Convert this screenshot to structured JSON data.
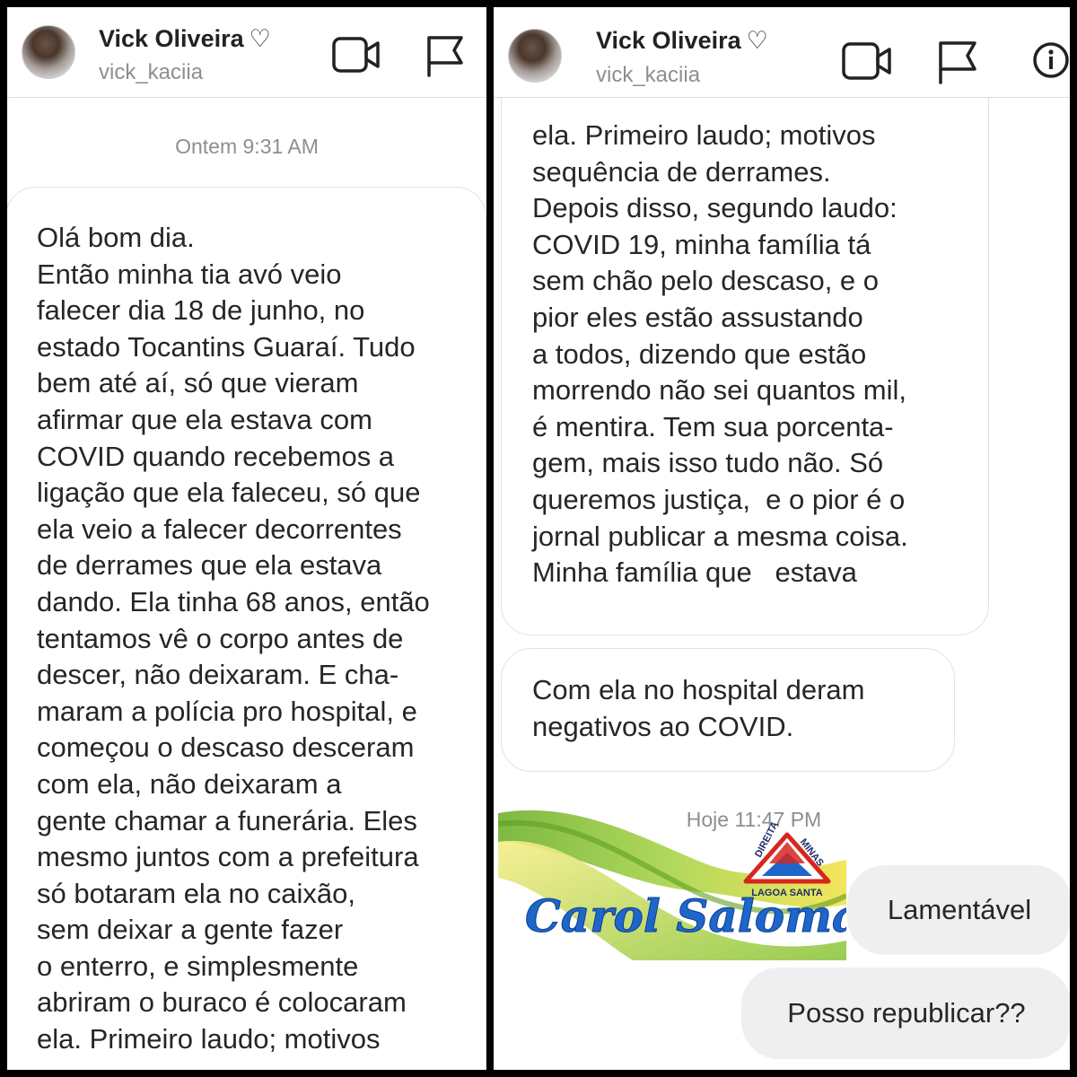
{
  "left_panel": {
    "header": {
      "name": "Vick Oliveira",
      "heart": "♡",
      "handle": "vick_kaciia",
      "video_icon": "video-call-icon",
      "flag_icon": "report-flag-icon"
    },
    "timestamp": "Ontem 9:31 AM",
    "message": "Olá bom dia.\nEntão minha tia avó veio\nfalecer dia 18 de junho, no\nestado Tocantins Guaraí. Tudo\nbem até aí, só que vieram\nafirmar que ela estava com\nCOVID quando recebemos a\nligação que ela faleceu, só que\nela veio a falecer decorrentes\nde derrames que ela estava\ndando. Ela tinha 68 anos, então\ntentamos vê o corpo antes de\ndescer, não deixaram. E cha-\nmaram a polícia pro hospital, e\ncomeçou o descaso desceram\ncom ela, não deixaram a\ngente chamar a funerária. Eles\nmesmo juntos com a prefeitura\nsó botaram ela no caixão,\nsem deixar a gente fazer\no enterro, e simplesmente\nabriram o buraco é colocaram\nela. Primeiro laudo; motivos"
  },
  "right_panel": {
    "header": {
      "name": "Vick Oliveira",
      "heart": "♡",
      "handle": "vick_kaciia",
      "video_icon": "video-call-icon",
      "flag_icon": "report-flag-icon",
      "info_icon": "info-icon"
    },
    "message_continued": "ela. Primeiro laudo; motivos\nsequência de derrames.\nDepois disso, segundo laudo:\nCOVID 19, minha família tá\nsem chão pelo descaso, e o\npior eles estão assustando\na todos, dizendo que estão\nmorrendo não sei quantos mil,\né mentira. Tem sua porcenta-\ngem, mais isso tudo não. Só\nqueremos justiça,  e o pior é o\njornal publicar a mesma coisa.\nMinha família que   estava",
    "message_2": "Com ela no hospital deram\nnegativos ao COVID.",
    "timestamp": "Hoje 11:47 PM",
    "outgoing_1": "Lamentável",
    "outgoing_2": "Posso republicar??"
  },
  "watermark": {
    "signature": "Carol Salomao",
    "badge_top": "DIREITA",
    "badge_right": "MINAS",
    "badge_bottom": "LAGOA SANTA",
    "colors": {
      "green": "#8dc63f",
      "yellow": "#f2e34a",
      "blue": "#1e66c9",
      "red": "#d7261e"
    }
  }
}
